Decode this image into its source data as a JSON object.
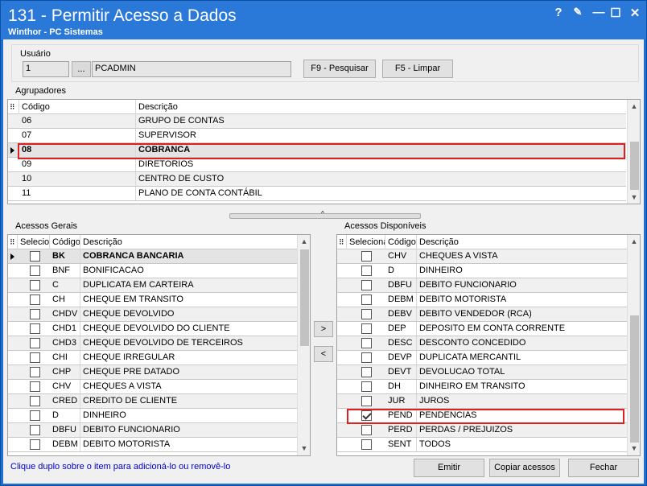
{
  "window": {
    "title": "131 - Permitir Acesso a Dados",
    "subtitle": "Winthor - PC Sistemas",
    "controls": {
      "help": "?",
      "edit": "✎",
      "minimize": "—",
      "maximize": "☐",
      "close": "✕"
    }
  },
  "usuario": {
    "label": "Usuário",
    "code": "1",
    "lookup_button": "...",
    "name": "PCADMIN",
    "btn_pesquisar": "F9 - Pesquisar",
    "btn_limpar": "F5 - Limpar"
  },
  "agrupadores": {
    "label": "Agrupadores",
    "col_codigo": "Código",
    "col_descricao": "Descrição",
    "rows": [
      {
        "codigo": "06",
        "descricao": "GRUPO DE CONTAS"
      },
      {
        "codigo": "07",
        "descricao": "SUPERVISOR"
      },
      {
        "codigo": "08",
        "descricao": "COBRANCA"
      },
      {
        "codigo": "09",
        "descricao": "DIRETORIOS"
      },
      {
        "codigo": "10",
        "descricao": "CENTRO DE CUSTO"
      },
      {
        "codigo": "11",
        "descricao": "PLANO DE CONTA CONTÁBIL"
      }
    ]
  },
  "acessos_gerais": {
    "label": "Acessos Gerais",
    "col_selec": "Selecio",
    "col_codigo": "Código",
    "col_descricao": "Descrição",
    "rows": [
      {
        "codigo": "BK",
        "descricao": "COBRANCA BANCARIA",
        "checked": false
      },
      {
        "codigo": "BNF",
        "descricao": "BONIFICACAO",
        "checked": false
      },
      {
        "codigo": "C",
        "descricao": "DUPLICATA EM CARTEIRA",
        "checked": false
      },
      {
        "codigo": "CH",
        "descricao": "CHEQUE EM TRANSITO",
        "checked": false
      },
      {
        "codigo": "CHDV",
        "descricao": "CHEQUE DEVOLVIDO",
        "checked": false
      },
      {
        "codigo": "CHD1",
        "descricao": "CHEQUE DEVOLVIDO DO CLIENTE",
        "checked": false
      },
      {
        "codigo": "CHD3",
        "descricao": "CHEQUE DEVOLVIDO DE TERCEIROS",
        "checked": false
      },
      {
        "codigo": "CHI",
        "descricao": "CHEQUE IRREGULAR",
        "checked": false
      },
      {
        "codigo": "CHP",
        "descricao": "CHEQUE PRE DATADO",
        "checked": false
      },
      {
        "codigo": "CHV",
        "descricao": "CHEQUES A VISTA",
        "checked": false
      },
      {
        "codigo": "CRED",
        "descricao": "CREDITO DE CLIENTE",
        "checked": false
      },
      {
        "codigo": "D",
        "descricao": "DINHEIRO",
        "checked": false
      },
      {
        "codigo": "DBFU",
        "descricao": "DEBITO FUNCIONARIO",
        "checked": false
      },
      {
        "codigo": "DEBM",
        "descricao": "DEBITO MOTORISTA",
        "checked": false
      }
    ]
  },
  "transfer": {
    "add": ">",
    "remove": "<"
  },
  "acessos_disponiveis": {
    "label": "Acessos Disponíveis",
    "col_selec": "Selecionar",
    "col_codigo": "Código",
    "col_descricao": "Descrição",
    "rows": [
      {
        "codigo": "CHV",
        "descricao": "CHEQUES A VISTA",
        "checked": false
      },
      {
        "codigo": "D",
        "descricao": "DINHEIRO",
        "checked": false
      },
      {
        "codigo": "DBFU",
        "descricao": "DEBITO FUNCIONARIO",
        "checked": false
      },
      {
        "codigo": "DEBM",
        "descricao": "DEBITO MOTORISTA",
        "checked": false
      },
      {
        "codigo": "DEBV",
        "descricao": "DEBITO VENDEDOR (RCA)",
        "checked": false
      },
      {
        "codigo": "DEP",
        "descricao": "DEPOSITO EM CONTA CORRENTE",
        "checked": false
      },
      {
        "codigo": "DESC",
        "descricao": "DESCONTO CONCEDIDO",
        "checked": false
      },
      {
        "codigo": "DEVP",
        "descricao": "DUPLICATA MERCANTIL",
        "checked": false
      },
      {
        "codigo": "DEVT",
        "descricao": "DEVOLUCAO TOTAL",
        "checked": false
      },
      {
        "codigo": "DH",
        "descricao": "DINHEIRO EM TRANSITO",
        "checked": false
      },
      {
        "codigo": "JUR",
        "descricao": "JUROS",
        "checked": false
      },
      {
        "codigo": "PEND",
        "descricao": "PENDENCIAS",
        "checked": true
      },
      {
        "codigo": "PERD",
        "descricao": "PERDAS / PREJUIZOS",
        "checked": false
      },
      {
        "codigo": "SENT",
        "descricao": "TODOS",
        "checked": false
      }
    ]
  },
  "footer": {
    "hint": "Clique duplo sobre o item para adicioná-lo ou removê-lo",
    "btn_emitir": "Emitir",
    "btn_copiar": "Copiar acessos",
    "btn_fechar": "Fechar"
  },
  "colors": {
    "title_bar": "#2a78d8",
    "highlight_box": "#e02020",
    "hint_text": "#0000cc"
  }
}
